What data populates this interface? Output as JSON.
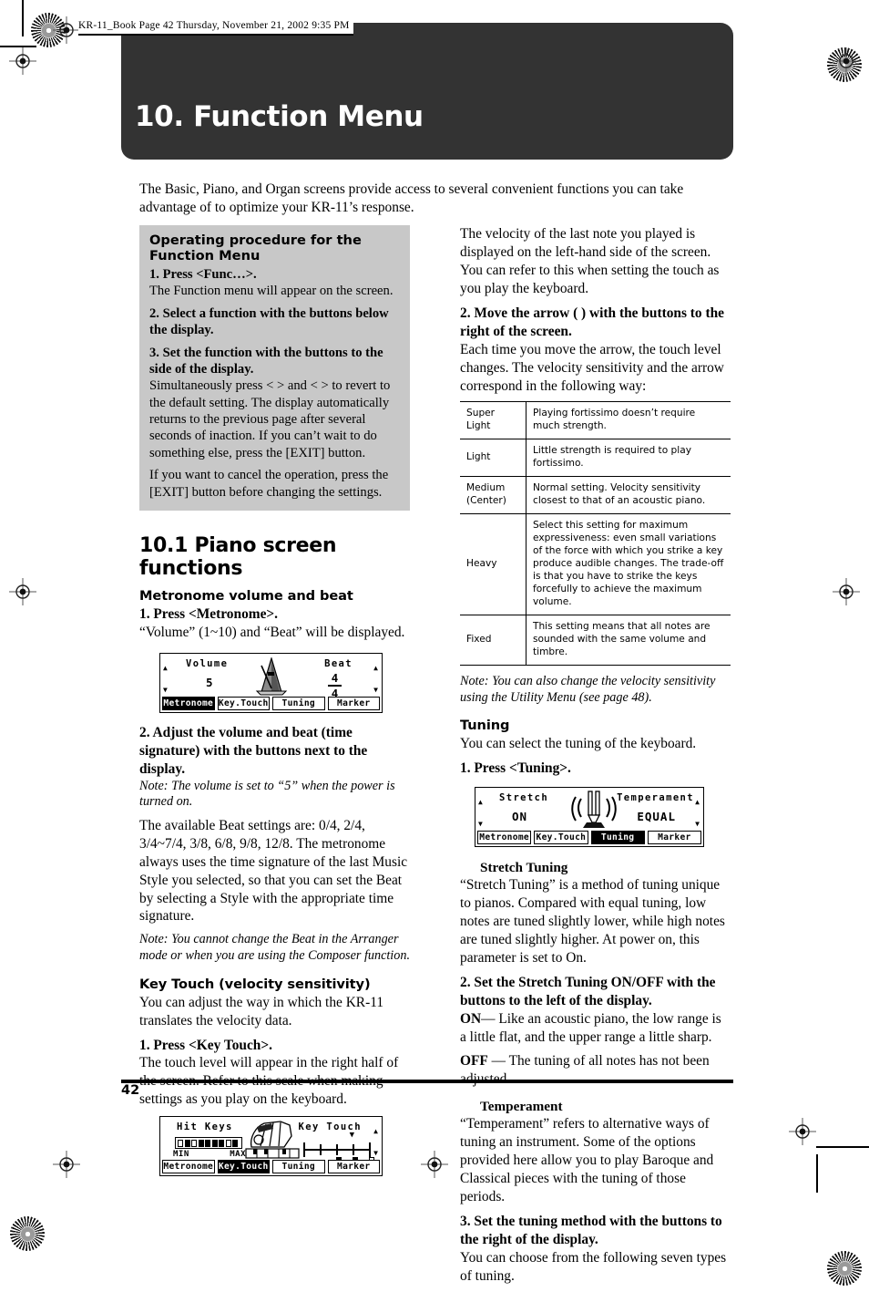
{
  "header": {
    "file_line": "KR-11_Book  Page 42  Thursday, November 21, 2002  9:35 PM"
  },
  "banner": {
    "title": "10. Function Menu"
  },
  "intro": {
    "text": "The Basic, Piano, and Organ screens provide access to several convenient functions you can take advantage of to optimize your KR-11’s response."
  },
  "procedure_box": {
    "title": "Operating procedure for the Function Menu",
    "step1_bold": "1. Press <Func…>.",
    "step1_text": "The Function menu will appear on the screen.",
    "step2_bold": "2. Select a function with the buttons below the display.",
    "step3_bold": "3. Set the function with the buttons to the side of the display.",
    "step3_text": "Simultaneously press <    > and <    > to revert to the default setting. The display automatically returns to the previous page after several seconds of inaction. If you can’t wait to do something else, press the [EXIT] button.",
    "step3_text2": "If you want to cancel the operation, press the [EXIT] button before changing the settings."
  },
  "section": {
    "heading": "10.1 Piano screen functions"
  },
  "metronome": {
    "heading": "Metronome volume and beat",
    "step1_bold": "1. Press <Metronome>.",
    "step1_text": "“Volume” (1~10) and “Beat” will be displayed.",
    "step2_bold": "2. Adjust the volume and beat (time signature) with the buttons next to the display.",
    "note1": "Note: The volume is set to “5” when the power is turned on.",
    "body": "The available Beat settings are: 0/4, 2/4, 3/4~7/4, 3/8, 6/8, 9/8, 12/8. The metronome always uses the time signature of the last Music Style you selected, so that you can set the Beat by selecting a Style with the appropriate time signature.",
    "note2": "Note: You cannot change the Beat in the Arranger mode or when you are using the Composer function."
  },
  "lcd_metronome": {
    "left_label": "Volume",
    "left_value": "5",
    "right_label": "Beat",
    "beat_numerator": "4",
    "beat_denominator": "4",
    "graphic": "metronome-icon",
    "tabs": [
      {
        "label": "Metronome",
        "selected": true
      },
      {
        "label": "Key.Touch",
        "selected": false
      },
      {
        "label": "Tuning",
        "selected": false
      },
      {
        "label": "Marker",
        "selected": false
      }
    ]
  },
  "key_touch": {
    "heading": "Key Touch (velocity sensitivity)",
    "intro": "You can adjust the way in which the KR-11 translates the velocity data.",
    "step1_bold": "1. Press <Key Touch>.",
    "step1_text": "The touch level will appear in the right half of the screen. Refer to this scale when making settings as you play on the keyboard."
  },
  "lcd_keytouch": {
    "left_label": "Hit Keys",
    "meter_min": "MIN",
    "meter_max": "MAX",
    "right_label": "Key Touch",
    "graphic": "hand-on-keys-icon",
    "tabs": [
      {
        "label": "Metronome",
        "selected": false
      },
      {
        "label": "Key.Touch",
        "selected": true
      },
      {
        "label": "Tuning",
        "selected": false
      },
      {
        "label": "Marker",
        "selected": false
      }
    ]
  },
  "right_col": {
    "velocity_intro": "The velocity of the last note you played is displayed on the left-hand side of the screen. You can refer to this when setting the touch as you play the keyboard.",
    "step2_bold": "2. Move the arrow (    ) with the buttons to the right of the screen.",
    "step2_text": "Each time you move the arrow, the touch level changes. The velocity sensitivity and the arrow correspond in the following way:",
    "note_velocity": "Note: You can also change the velocity sensitivity using the Utility Menu (see page 48)."
  },
  "velocity_table": {
    "rows": [
      {
        "key": "Super\nLight",
        "desc": "Playing fortissimo doesn’t require much strength."
      },
      {
        "key": "Light",
        "desc": "Little strength is required to play fortissimo."
      },
      {
        "key": "Medium\n(Center)",
        "desc": "Normal setting. Velocity sensitivity closest to that of an acoustic piano."
      },
      {
        "key": "Heavy",
        "desc": "Select this setting for maximum expressiveness: even small variations of the force with which you strike a key produce audible changes. The trade-off is that you have to strike the keys forcefully to achieve the maximum volume."
      },
      {
        "key": "Fixed",
        "desc": "This setting means that all notes are sounded with the same volume and timbre."
      }
    ]
  },
  "tuning": {
    "heading": "Tuning",
    "intro": "You can select the tuning of the keyboard.",
    "step1_bold": "1. Press <Tuning>."
  },
  "lcd_tuning": {
    "left_label": "Stretch",
    "left_value": "ON",
    "right_label": "Temperament",
    "right_value": "EQUAL",
    "graphic": "tuning-fork-icon",
    "tabs": [
      {
        "label": "Metronome",
        "selected": false
      },
      {
        "label": "Key.Touch",
        "selected": false
      },
      {
        "label": "Tuning",
        "selected": true
      },
      {
        "label": "Marker",
        "selected": false
      }
    ]
  },
  "stretch": {
    "heading": "Stretch Tuning",
    "body": "“Stretch Tuning” is a method of tuning unique to pianos. Compared with equal tuning, low notes are tuned slightly lower, while high notes are tuned slightly higher. At power on, this parameter is set to On.",
    "step2_bold": "2. Set the Stretch Tuning ON/OFF with the buttons to the left of the display.",
    "on_label": "ON",
    "on_text": "— Like an acoustic piano, the low range is a little flat, and the upper range a little sharp.",
    "off_label": "OFF",
    "off_text": " — The tuning of all notes has not been adjusted."
  },
  "temperament": {
    "heading": "Temperament",
    "body": "“Temperament” refers to alternative ways of tuning an instrument. Some of the options provided here allow you to play Baroque and Classical pieces with the tuning of those periods.",
    "step3_bold": "3. Set the tuning method with the buttons to the right of the display.",
    "step3_text": "You can choose from the following seven types of tuning."
  },
  "footer": {
    "page_number": "42"
  }
}
